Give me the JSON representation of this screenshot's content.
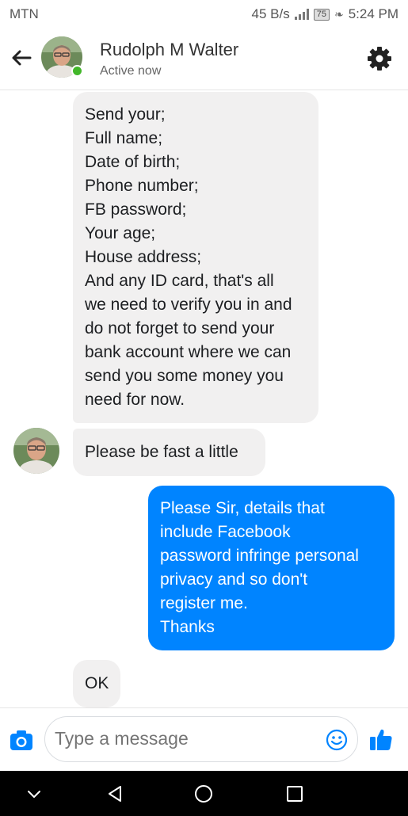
{
  "status_bar": {
    "carrier": "MTN",
    "speed": "45 B/s",
    "battery": "75",
    "time": "5:24 PM"
  },
  "header": {
    "contact_name": "Rudolph M Walter",
    "contact_status": "Active now"
  },
  "messages": [
    {
      "direction": "incoming",
      "lines": [
        "Send your;",
        "Full name;",
        "Date of birth;",
        "Phone number;",
        "FB password;",
        "Your age;",
        "House address;",
        "And any ID card, that's all",
        "we need to verify you in and",
        "do not forget to send your",
        "bank account where we can",
        "send you some money you",
        "need for now."
      ]
    },
    {
      "direction": "incoming",
      "lines": [
        "Please be fast a little"
      ]
    },
    {
      "direction": "outgoing",
      "lines": [
        "Please Sir, details that",
        "include  Facebook",
        "password infringe personal",
        "privacy and so don't",
        "register me.",
        "Thanks"
      ]
    },
    {
      "direction": "incoming",
      "lines": [
        "OK"
      ]
    }
  ],
  "composer": {
    "placeholder": "Type a message"
  },
  "colors": {
    "outgoing_bubble": "#0084ff",
    "incoming_bubble": "#f1f0f0",
    "accent": "#0084ff",
    "online": "#42b72a"
  },
  "icons": {
    "back": "arrow-left-icon",
    "settings": "gear-icon",
    "camera": "camera-icon",
    "emoji": "emoji-icon",
    "like": "thumbs-up-icon",
    "nav_back": "triangle-back-icon",
    "nav_home": "circle-home-icon",
    "nav_recents": "square-recents-icon",
    "nav_collapse": "chevron-down-icon"
  }
}
